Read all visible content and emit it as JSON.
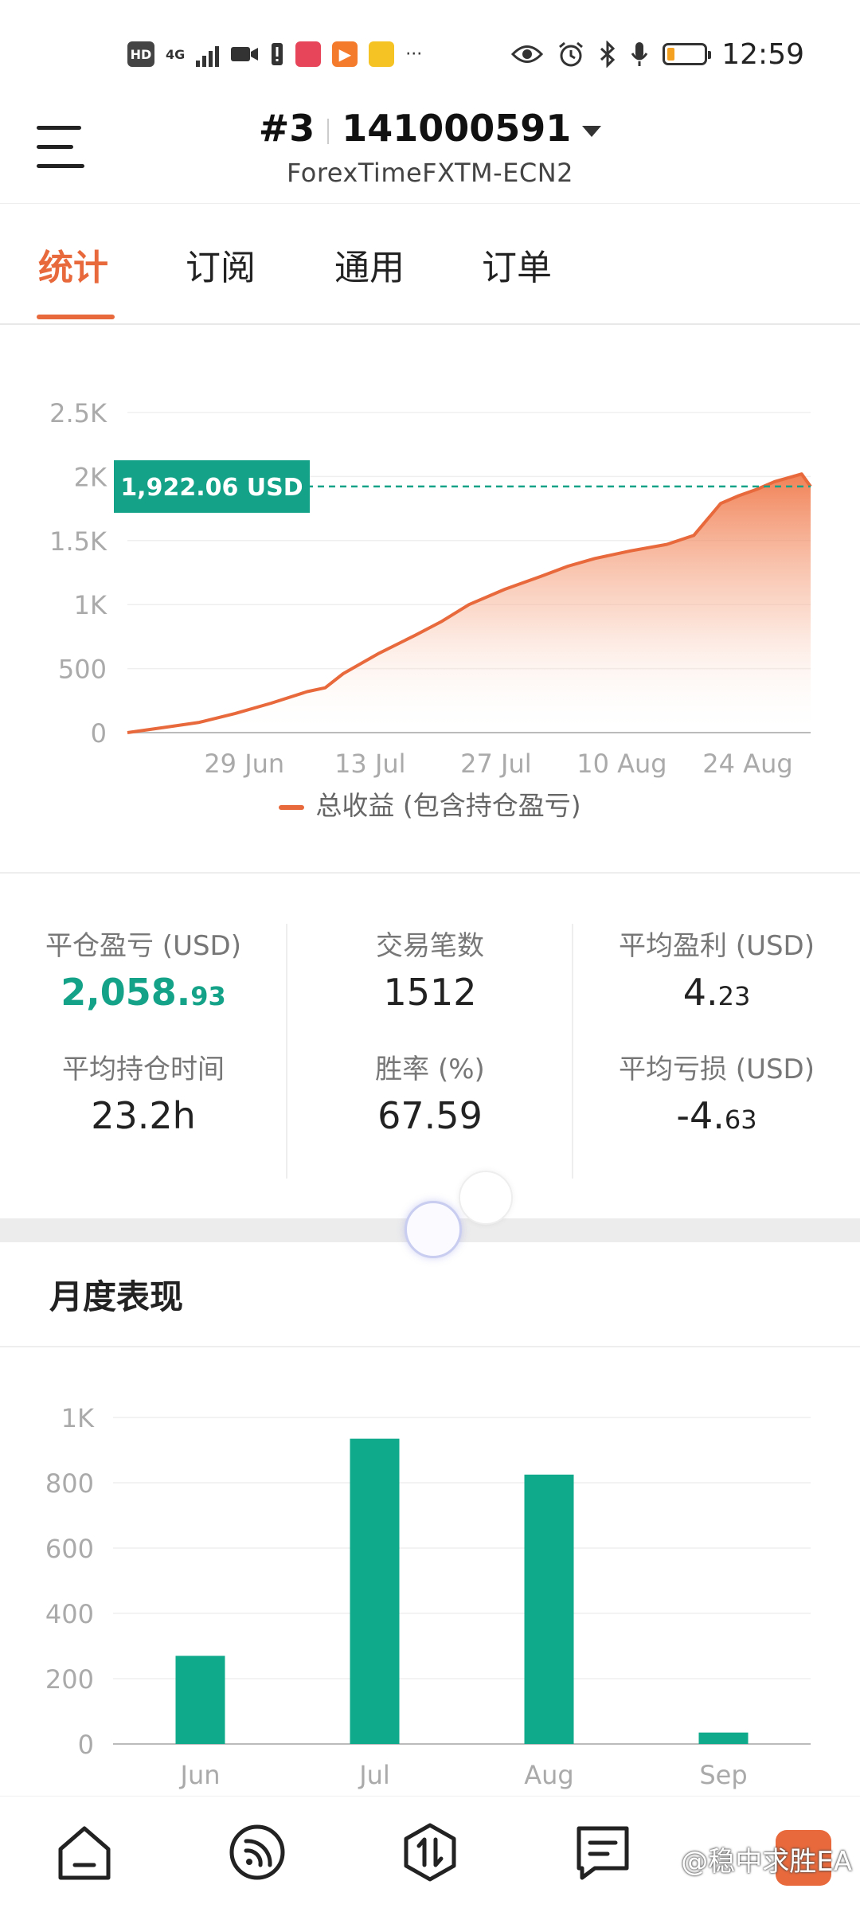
{
  "status_bar": {
    "hd": "HD",
    "network": "4G",
    "time": "12:59",
    "battery_level": 0.2,
    "icons": [
      "video-icon",
      "alert-icon",
      "book-app-icon",
      "video-app-icon",
      "game-app-icon",
      "more-icon",
      "eye-icon",
      "alarm-icon",
      "bluetooth-icon",
      "mic-icon"
    ]
  },
  "header": {
    "account_number": "#3",
    "account_id": "141000591",
    "server": "ForexTimeFXTM-ECN2"
  },
  "tabs": [
    {
      "label": "统计",
      "active": true
    },
    {
      "label": "订阅",
      "active": false
    },
    {
      "label": "通用",
      "active": false
    },
    {
      "label": "订单",
      "active": false
    }
  ],
  "colors": {
    "accent": "#e8693c",
    "green": "#14a388",
    "bar": "#0fa98b"
  },
  "chart_data": [
    {
      "type": "area",
      "x_ticks": [
        "29 Jun",
        "13 Jul",
        "27 Jul",
        "10 Aug",
        "24 Aug"
      ],
      "y_ticks": [
        "0",
        "500",
        "1K",
        "1.5K",
        "2K",
        "2.5K"
      ],
      "ylim": [
        0,
        2500
      ],
      "current_value_label": "1,922.06 USD",
      "current_value": 1922.06,
      "legend": [
        "总收益 (包含持仓盈亏)"
      ],
      "series": [
        {
          "name": "总收益 (包含持仓盈亏)",
          "x": [
            "Jun 16",
            "Jun 20",
            "Jun 24",
            "Jun 28",
            "Jul 2",
            "Jul 6",
            "Jul 8",
            "Jul 10",
            "Jul 14",
            "Jul 18",
            "Jul 21",
            "Jul 24",
            "Jul 28",
            "Aug 1",
            "Aug 4",
            "Aug 7",
            "Aug 11",
            "Aug 15",
            "Aug 18",
            "Aug 21",
            "Aug 23",
            "Aug 25",
            "Aug 27",
            "Aug 29",
            "Aug 30",
            "Aug 31"
          ],
          "values": [
            0,
            40,
            80,
            150,
            230,
            320,
            350,
            460,
            620,
            760,
            870,
            1000,
            1120,
            1220,
            1300,
            1360,
            1420,
            1470,
            1540,
            1790,
            1850,
            1900,
            1960,
            2000,
            2020,
            1922.06
          ]
        }
      ]
    },
    {
      "type": "bar",
      "title": "月度表现",
      "categories": [
        "Jun",
        "Jul",
        "Aug",
        "Sep"
      ],
      "values": [
        270,
        935,
        825,
        35
      ],
      "y_ticks": [
        "0",
        "200",
        "400",
        "600",
        "800",
        "1K"
      ],
      "ylim": [
        0,
        1000
      ]
    }
  ],
  "stats": {
    "closed_pl": {
      "label": "平仓盈亏 (USD)",
      "int": "2,058.",
      "dec": "93"
    },
    "trades": {
      "label": "交易笔数",
      "value": "1512"
    },
    "avg_profit": {
      "label": "平均盈利 (USD)",
      "int": "4.",
      "dec": "23"
    },
    "avg_hold": {
      "label": "平均持仓时间",
      "value": "23.2h"
    },
    "win_rate": {
      "label": "胜率 (%)",
      "value": "67.59"
    },
    "avg_loss": {
      "label": "平均亏损 (USD)",
      "int": "-4.",
      "dec": "63"
    }
  },
  "monthly": {
    "title": "月度表现"
  },
  "bottom_nav": {
    "items": [
      "home-icon",
      "feed-icon",
      "trade-icon",
      "messages-icon"
    ],
    "watermark": "@稳中求胜EA"
  }
}
